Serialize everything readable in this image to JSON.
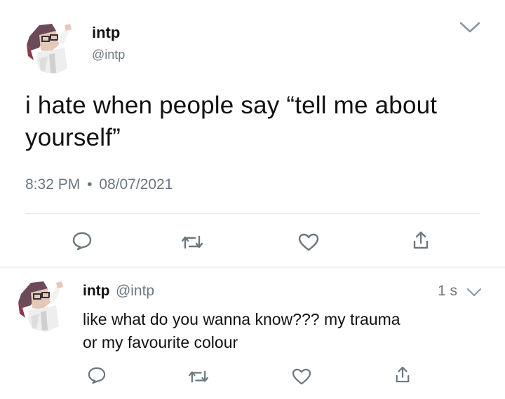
{
  "tweet": {
    "author_name": "intp",
    "author_handle": "@intp",
    "text_line1": "i hate when people say “tell me about",
    "text_line2": "yourself”",
    "time": "8:32 PM",
    "separator": "•",
    "date": "08/07/2021"
  },
  "reply": {
    "author_name": "intp",
    "author_handle": "@intp",
    "age": "1 s",
    "text_line1": "like what do you wanna know??? my trauma",
    "text_line2": "or my favourite colour"
  },
  "icons": {
    "reply": "reply-icon",
    "retweet": "retweet-icon",
    "like": "heart-icon",
    "share": "share-icon",
    "more": "chevron-down-icon"
  },
  "colors": {
    "text": "#111111",
    "secondary": "#6b7780",
    "divider": "#d6dadd",
    "icon": "#6b7780"
  }
}
